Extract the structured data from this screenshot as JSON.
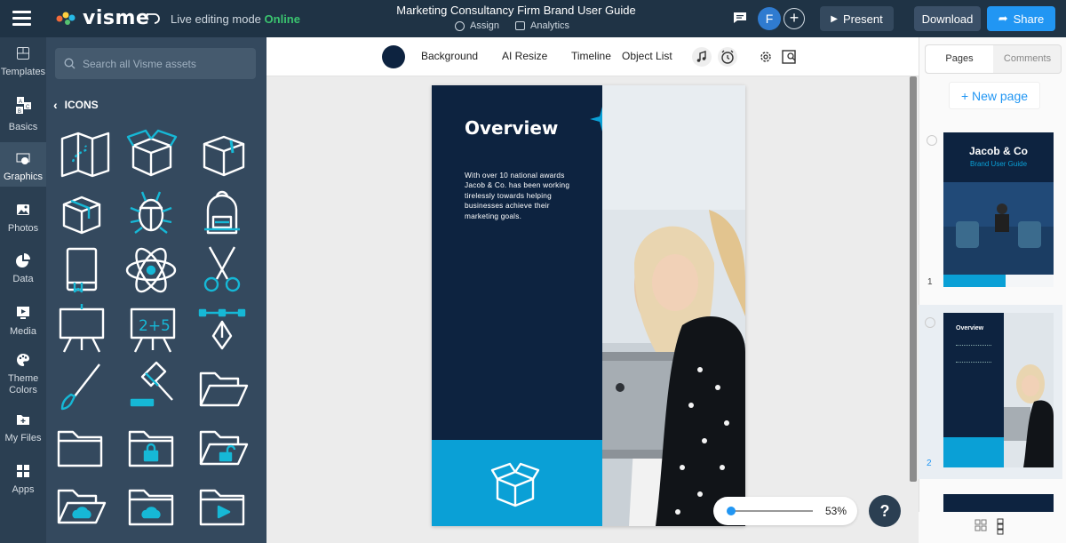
{
  "topbar": {
    "logo_text": "visme",
    "mode_label": "Live editing mode",
    "mode_status": "Online",
    "doc_title": "Marketing Consultancy Firm Brand User Guide",
    "assign_label": "Assign",
    "analytics_label": "Analytics",
    "avatar_initial": "F",
    "present_label": "Present",
    "download_label": "Download",
    "share_label": "Share"
  },
  "rail": {
    "items": [
      {
        "label": "Templates"
      },
      {
        "label": "Basics"
      },
      {
        "label": "Graphics"
      },
      {
        "label": "Photos"
      },
      {
        "label": "Data"
      },
      {
        "label": "Media"
      },
      {
        "label": "Theme Colors"
      },
      {
        "label": "My Files"
      },
      {
        "label": "Apps"
      }
    ]
  },
  "panel": {
    "search_placeholder": "Search all Visme assets",
    "section_title": "ICONS",
    "icons": [
      "map-icon",
      "open-box-icon",
      "box-icon",
      "package-icon",
      "bug-icon",
      "backpack-icon",
      "book-icon",
      "atom-icon",
      "scissors-icon",
      "easel-icon",
      "math-board-icon",
      "pen-tool-icon",
      "brush-icon",
      "gavel-icon",
      "open-folder-icon",
      "folder-icon",
      "locked-folder-icon",
      "unlocked-folder-icon",
      "cloud-folder-icon",
      "cloud-folder-2-icon",
      "video-folder-icon"
    ]
  },
  "toolbar": {
    "background_label": "Background",
    "ai_resize_label": "AI Resize",
    "timeline_label": "Timeline",
    "object_list_label": "Object List"
  },
  "canvas": {
    "page_title": "Overview",
    "page_body": "With over 10 national awards Jacob & Co. has been working tirelessly towards helping businesses achieve their marketing goals.",
    "zoom": "53%",
    "help": "?"
  },
  "colors": {
    "navy": "#0d2340",
    "accent": "#0aa0d6",
    "topbar": "#1f3345",
    "online": "#3ac46f",
    "share": "#2196f3"
  },
  "rpanel": {
    "tab_pages": "Pages",
    "tab_comments": "Comments",
    "new_page_label": "+ New page",
    "thumb1_title": "Jacob & Co",
    "thumb1_sub": "Brand User Guide",
    "thumb1_num": "1",
    "thumb2_title": "Overview",
    "thumb2_num": "2"
  }
}
